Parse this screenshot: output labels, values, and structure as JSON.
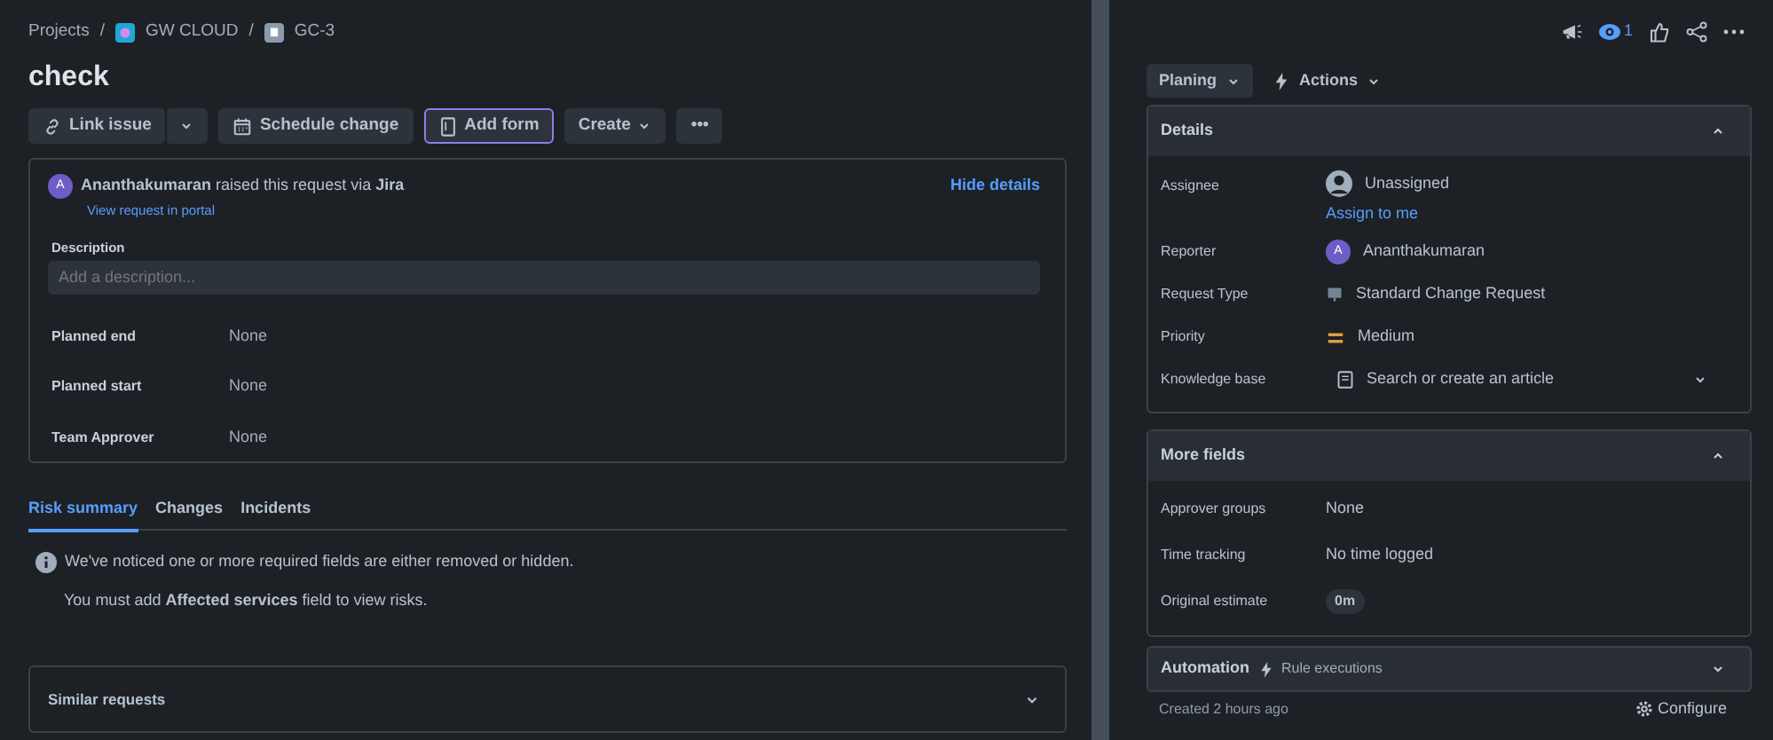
{
  "breadcrumb": [
    {
      "label": "Projects"
    },
    {
      "separator": "/",
      "label": "GW CLOUD"
    },
    {
      "separator": "/",
      "label": "GC-3"
    }
  ],
  "title": "check",
  "toolbar": [
    {
      "label": "Link issue",
      "kind": "split",
      "focused": false
    },
    {
      "label": "Schedule change",
      "kind": "plain",
      "focused": false
    },
    {
      "label": "Add form",
      "kind": "plain",
      "focused": true
    },
    {
      "label": "Create",
      "kind": "dropdown",
      "focused": false
    },
    {
      "label": "•••",
      "kind": "plain",
      "focused": false
    }
  ],
  "request": {
    "avatar": "A",
    "author": "Ananthakumaran",
    "text": "raised this request via",
    "via": "Jira",
    "portal_link": "View request in portal",
    "hide_link": "Hide details",
    "description_label": "Description",
    "description_placeholder": "Add a description...",
    "fields": [
      {
        "label": "Planned end",
        "value": "None"
      },
      {
        "label": "Planned start",
        "value": "None"
      },
      {
        "label": "Team Approver",
        "value": "None"
      }
    ]
  },
  "tabs": [
    {
      "label": "Risk summary",
      "selected": true
    },
    {
      "label": "Changes",
      "selected": false
    },
    {
      "label": "Incidents",
      "selected": false
    }
  ],
  "risk": {
    "notice": "We've noticed one or more required fields are either removed or hidden.",
    "hint": "You must add **Affected services** field to view risks."
  },
  "similar_requests": {
    "title": "Similar requests",
    "expanded": false
  },
  "top_icons": {
    "watchers": "1"
  },
  "status_button": "Planing",
  "actions_button": "Actions",
  "details": {
    "title": "Details",
    "expanded": true,
    "rows": [
      {
        "label": "Assignee",
        "kind": "assignee",
        "value": "Unassigned",
        "link": "Assign to me"
      },
      {
        "label": "Reporter",
        "kind": "user",
        "value": "Ananthakumaran",
        "avatar": "A"
      },
      {
        "label": "Request Type",
        "kind": "request-type",
        "value": "Standard Change Request"
      },
      {
        "label": "Priority",
        "kind": "priority",
        "value": "Medium"
      },
      {
        "label": "Knowledge base",
        "kind": "search",
        "value": "Search or create an article"
      }
    ]
  },
  "more_fields": {
    "title": "More fields",
    "expanded": true,
    "rows": [
      {
        "label": "Approver groups",
        "kind": "text",
        "value": "None"
      },
      {
        "label": "Time tracking",
        "kind": "text",
        "value": "No time logged"
      },
      {
        "label": "Original estimate",
        "kind": "pill",
        "value": "0m"
      }
    ]
  },
  "automation": {
    "title": "Automation",
    "subtitle": "Rule executions",
    "expanded": false
  },
  "footer": {
    "created": "Created 2 hours ago",
    "configure": "Configure"
  }
}
